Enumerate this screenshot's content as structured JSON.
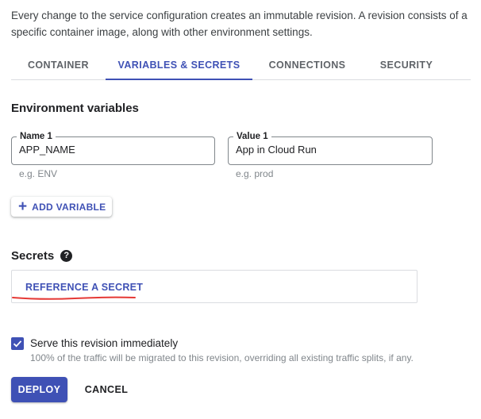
{
  "intro": "Every change to the service configuration creates an immutable revision. A revision consists of a specific container image, along with other environment settings.",
  "tabs": [
    {
      "label": "CONTAINER",
      "active": false
    },
    {
      "label": "VARIABLES & SECRETS",
      "active": true
    },
    {
      "label": "CONNECTIONS",
      "active": false
    },
    {
      "label": "SECURITY",
      "active": false
    }
  ],
  "env": {
    "title": "Environment variables",
    "name_label": "Name 1",
    "name_value": "APP_NAME",
    "name_hint": "e.g. ENV",
    "value_label": "Value 1",
    "value_value": "App in Cloud Run",
    "value_hint": "e.g. prod",
    "add_label": "ADD VARIABLE"
  },
  "secrets": {
    "title": "Secrets",
    "reference_label": "REFERENCE A SECRET"
  },
  "serve": {
    "checked": true,
    "label": "Serve this revision immediately",
    "hint": "100% of the traffic will be migrated to this revision, overriding all existing traffic splits, if any."
  },
  "actions": {
    "deploy_label": "DEPLOY",
    "cancel_label": "CANCEL"
  },
  "colors": {
    "accent": "#3f51b5",
    "annotation": "#e53935"
  },
  "icons": {
    "add": "plus-icon",
    "help": "help-icon",
    "check": "check-icon"
  }
}
